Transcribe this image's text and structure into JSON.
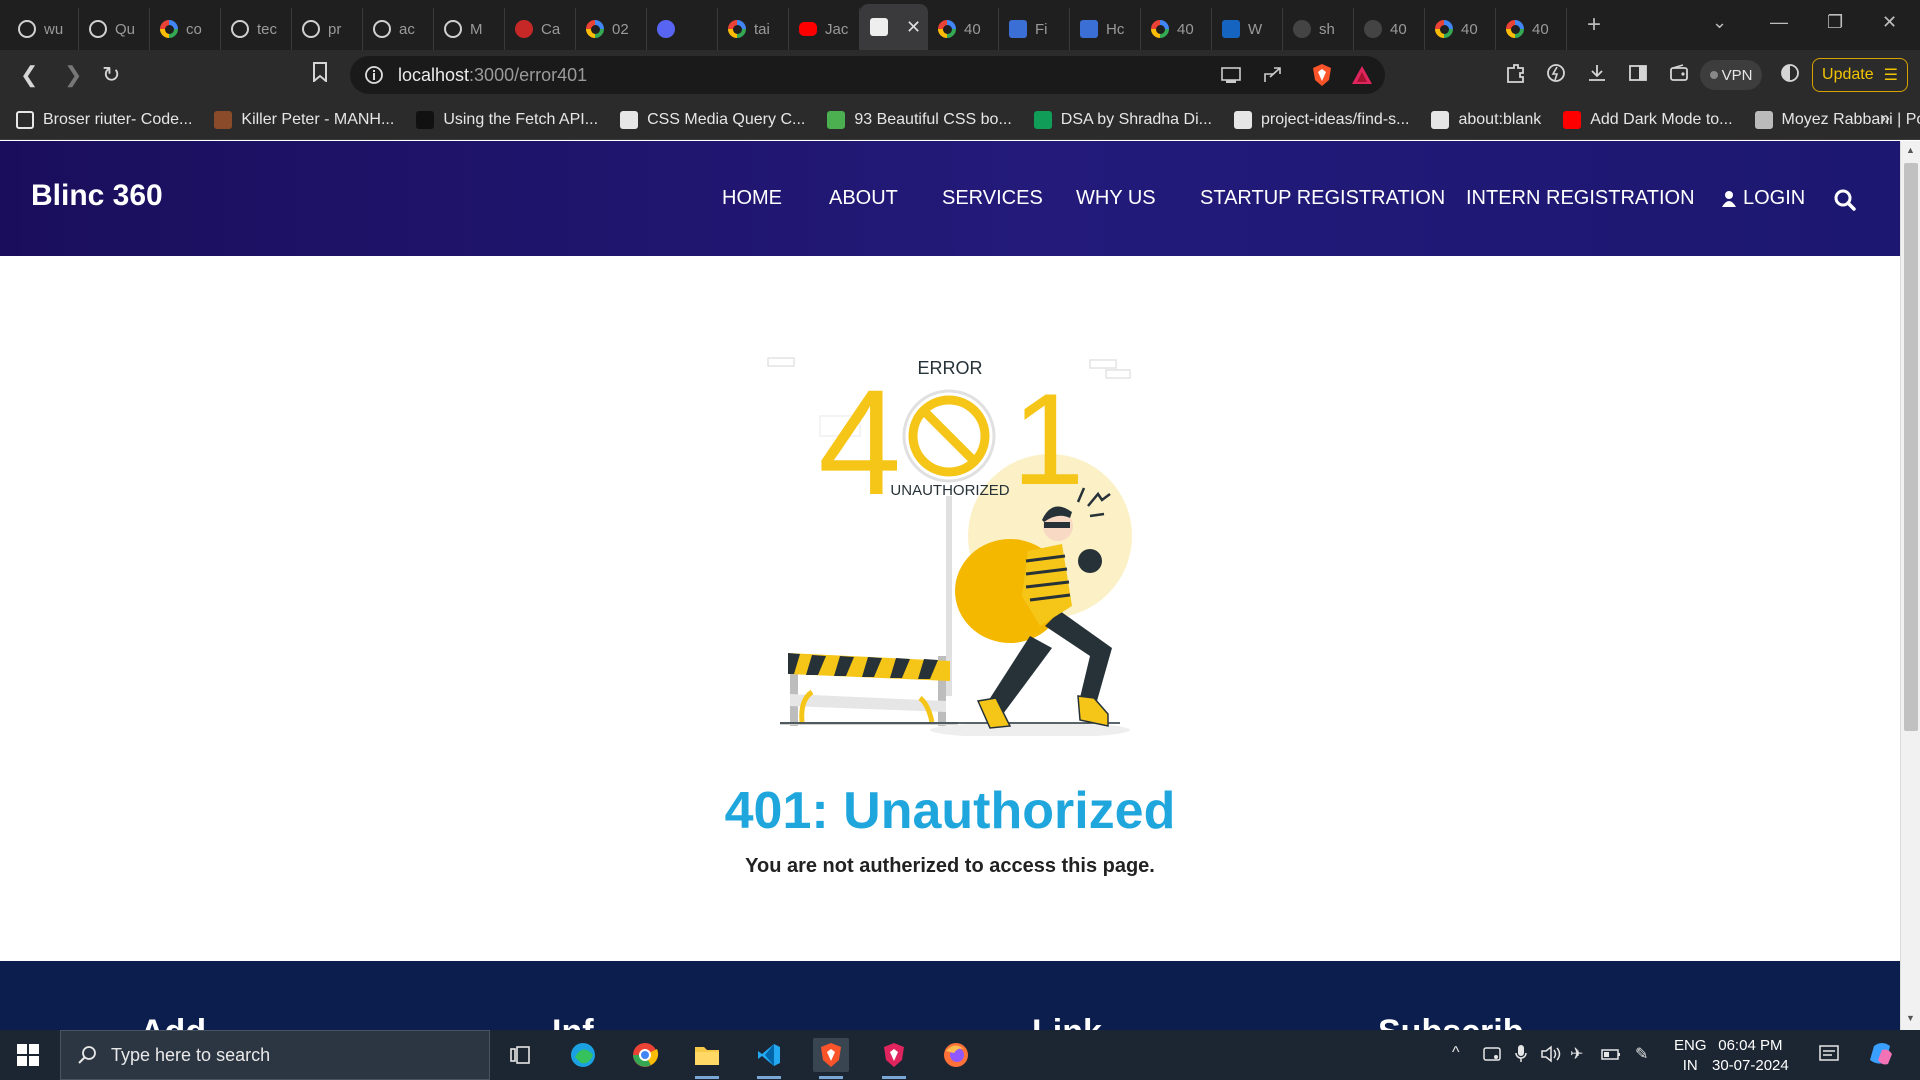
{
  "browser": {
    "tabs": [
      {
        "label": "wu",
        "icon": "openai-icon"
      },
      {
        "label": "Qu",
        "icon": "openai-icon"
      },
      {
        "label": "co",
        "icon": "google-icon"
      },
      {
        "label": "tec",
        "icon": "openai-icon"
      },
      {
        "label": "pr",
        "icon": "openai-icon"
      },
      {
        "label": "ac",
        "icon": "openai-icon"
      },
      {
        "label": "M",
        "icon": "openai-icon"
      },
      {
        "label": "Ca",
        "icon": "record-icon"
      },
      {
        "label": "02",
        "icon": "google-icon"
      },
      {
        "label": "",
        "icon": "discord-icon"
      },
      {
        "label": "tai",
        "icon": "google-icon"
      },
      {
        "label": "Jac",
        "icon": "youtube-icon"
      },
      {
        "label": "",
        "icon": "page-icon",
        "active": true
      },
      {
        "label": "40",
        "icon": "google-icon"
      },
      {
        "label": "Fi",
        "icon": "vscode-icon"
      },
      {
        "label": "Hc",
        "icon": "vscode-icon"
      },
      {
        "label": "40",
        "icon": "google-icon"
      },
      {
        "label": "W",
        "icon": "doc-icon"
      },
      {
        "label": "sh",
        "icon": "globe-icon"
      },
      {
        "label": "40",
        "icon": "drive-icon"
      },
      {
        "label": "40",
        "icon": "google-icon"
      },
      {
        "label": "40",
        "icon": "google-icon"
      }
    ],
    "url_host": "localhost",
    "url_path": ":3000/error401",
    "vpn_label": "VPN",
    "update_label": "Update",
    "bookmarks": [
      {
        "label": "Broser riuter- Code...",
        "color": "#2b2b2c"
      },
      {
        "label": "Killer Peter - MANH...",
        "color": "#8a4b2a"
      },
      {
        "label": "Using the Fetch API...",
        "color": "#111111"
      },
      {
        "label": "CSS Media Query C...",
        "color": "#e6e6e6"
      },
      {
        "label": "93 Beautiful CSS bo...",
        "color": "#4caf50"
      },
      {
        "label": "DSA by Shradha Di...",
        "color": "#0f9d58"
      },
      {
        "label": "project-ideas/find-s...",
        "color": "#e6e6e6"
      },
      {
        "label": "about:blank",
        "color": "#e6e6e6"
      },
      {
        "label": "Add Dark Mode to...",
        "color": "#ff0000"
      },
      {
        "label": "Moyez Rabbani | Po...",
        "color": "#bbbbbb"
      }
    ]
  },
  "site": {
    "brand": "Blinc 360",
    "nav": [
      "HOME",
      "ABOUT",
      "SERVICES",
      "WHY US",
      "STARTUP REGISTRATION",
      "INTERN REGISTRATION"
    ],
    "login_label": "LOGIN",
    "illustration": {
      "top_text": "ERROR",
      "digits_left": "4",
      "digits_right": "1",
      "bottom_text": "UNAUTHORIZED"
    },
    "error_title": "401: Unauthorized",
    "error_message": "You are not autherized to access this page.",
    "footer_headings": [
      "Add",
      "Inf",
      "Link",
      "Subscrib"
    ]
  },
  "taskbar": {
    "search_placeholder": "Type here to search",
    "lang_top": "ENG",
    "lang_bottom": "IN",
    "time": "06:04 PM",
    "date": "30-07-2024"
  },
  "colors": {
    "accent_title": "#1fa6dc",
    "nav_gradient_start": "#1a0e5c",
    "footer_bg": "#0c1e4d",
    "illustration_yellow": "#f5c518"
  }
}
